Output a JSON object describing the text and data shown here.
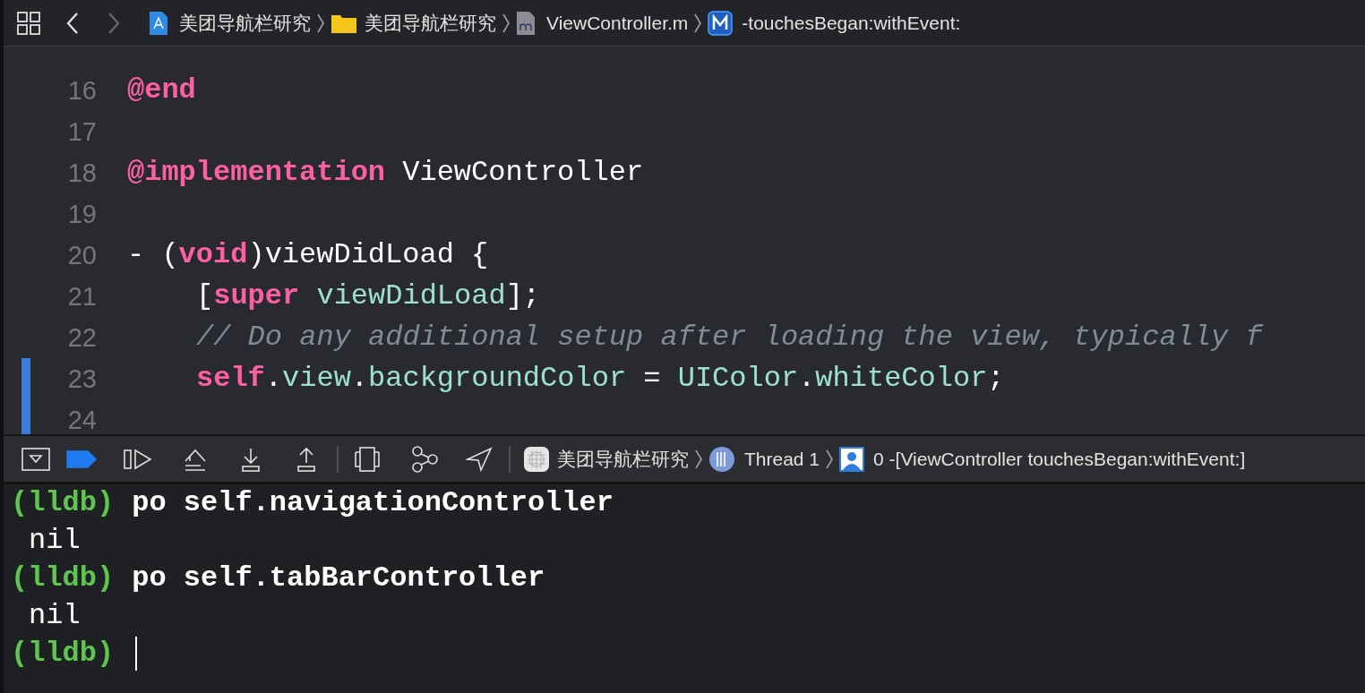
{
  "toolbar": {
    "back": {
      "disabled": false
    },
    "forward": {
      "disabled": true
    }
  },
  "breadcrumbs": [
    {
      "kind": "project",
      "text": "美团导航栏研究"
    },
    {
      "kind": "folder",
      "text": "美团导航栏研究"
    },
    {
      "kind": "file",
      "text": "ViewController.m"
    },
    {
      "kind": "method",
      "text": "-touchesBegan:withEvent:"
    }
  ],
  "editor": {
    "lines": [
      {
        "number": "16",
        "changed": false,
        "tokens": [
          {
            "kind": "keyword",
            "text": "@end"
          }
        ]
      },
      {
        "number": "17",
        "changed": false
      },
      {
        "number": "18",
        "changed": false,
        "tokens": [
          {
            "kind": "keyword",
            "text": "@implementation"
          },
          {
            "kind": "plain",
            "text": " ViewController"
          }
        ]
      },
      {
        "number": "19",
        "changed": false
      },
      {
        "number": "20",
        "changed": false,
        "tokens": [
          {
            "kind": "plain",
            "text": "- ("
          },
          {
            "kind": "keyword",
            "text": "void"
          },
          {
            "kind": "plain",
            "text": ")viewDidLoad {"
          }
        ],
        "children": [
          {
            "number": "21",
            "changed": false,
            "tokens": [
              {
                "kind": "plain",
                "text": "["
              },
              {
                "kind": "keyword",
                "text": "super"
              },
              {
                "kind": "method",
                "text": " viewDidLoad"
              },
              {
                "kind": "plain",
                "text": "];"
              }
            ]
          },
          {
            "number": "22",
            "changed": false,
            "tokens": [
              {
                "kind": "comment",
                "text": "// Do any additional setup after loading the view, typically f"
              }
            ]
          },
          {
            "number": "23",
            "changed": true,
            "tokens": [
              {
                "kind": "keyword",
                "text": "self"
              },
              {
                "kind": "plain",
                "text": "."
              },
              {
                "kind": "method",
                "text": "view"
              },
              {
                "kind": "plain",
                "text": "."
              },
              {
                "kind": "method",
                "text": "backgroundColor"
              },
              {
                "kind": "plain",
                "text": " = "
              },
              {
                "kind": "method",
                "text": "UIColor"
              },
              {
                "kind": "plain",
                "text": "."
              },
              {
                "kind": "method",
                "text": "whiteColor"
              },
              {
                "kind": "plain",
                "text": ";"
              }
            ]
          }
        ]
      },
      {
        "number": "24",
        "changed": true
      }
    ]
  },
  "debug_bar": {
    "breakpoints_active": true,
    "path": [
      {
        "kind": "app",
        "text": "美团导航栏研究"
      },
      {
        "kind": "thread",
        "text": "Thread 1"
      },
      {
        "kind": "frame",
        "text": "0 -[ViewController touchesBegan:withEvent:]"
      }
    ]
  },
  "console": {
    "lines": [
      {
        "kind": "command",
        "prompt": "(lldb)",
        "text": "po self.navigationController"
      },
      {
        "kind": "output",
        "text": "nil"
      },
      {
        "kind": "command",
        "prompt": "(lldb)",
        "text": "po self.tabBarController"
      },
      {
        "kind": "output",
        "text": "nil"
      },
      {
        "kind": "command",
        "prompt": "(lldb)",
        "cursor": true
      }
    ]
  }
}
